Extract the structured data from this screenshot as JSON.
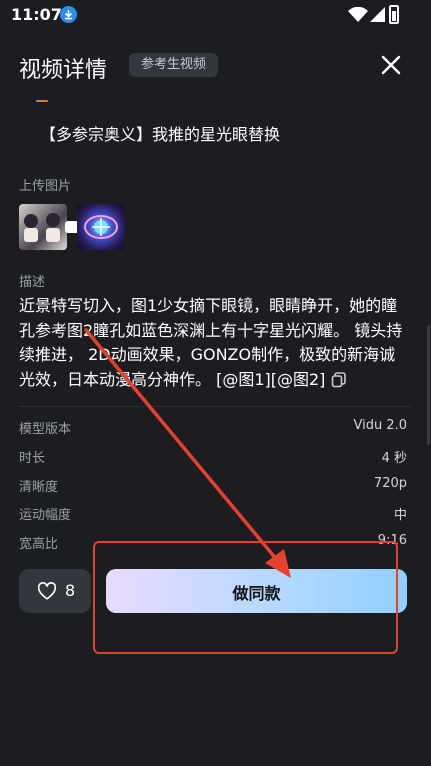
{
  "status": {
    "time": "11:07"
  },
  "header": {
    "title": "视频详情",
    "badge": "参考生视频"
  },
  "reference_title": "【多参宗奥义】我推的星光眼替换",
  "upload": {
    "label": "上传图片"
  },
  "description": {
    "label": "描述",
    "text": "近景特写切入，图1少女摘下眼镜，眼睛睁开，她的瞳孔参考图2瞳孔如蓝色深渊上有十字星光闪耀。 镜头持续推进， 2D动画效果，GONZO制作，极致的新海诚光效，日本动漫高分神作。 [@图1][@图2]"
  },
  "info": [
    {
      "key": "模型版本",
      "value": "Vidu 2.0"
    },
    {
      "key": "时长",
      "value": "4 秒"
    },
    {
      "key": "清晰度",
      "value": "720p"
    },
    {
      "key": "运动幅度",
      "value": "中"
    },
    {
      "key": "宽高比",
      "value": "9:16"
    }
  ],
  "actions": {
    "like_count": "8",
    "make_same_label": "做同款"
  },
  "colors": {
    "background": "#1c1d21",
    "annotation": "#e5422e",
    "gradient_start": "#e9dbff",
    "gradient_end": "#8fd0ff"
  }
}
